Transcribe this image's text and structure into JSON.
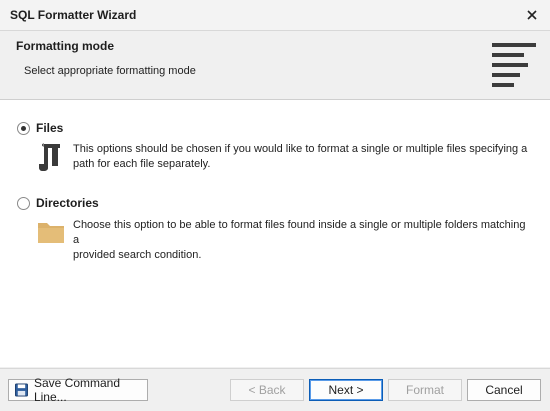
{
  "window": {
    "title": "SQL Formatter Wizard"
  },
  "header": {
    "title": "Formatting mode",
    "subtitle": "Select appropriate formatting mode"
  },
  "options": [
    {
      "label": "Files",
      "checked": true,
      "description_lines": [
        "This options should be chosen if you would like to format a single or multiple files specifying a",
        "path for each file separately."
      ],
      "icon": "file-icon"
    },
    {
      "label": "Directories",
      "checked": false,
      "description_lines": [
        "Choose this option to be able to format files found inside a single or multiple folders matching a",
        "provided search condition."
      ],
      "icon": "folder-icon"
    }
  ],
  "footer": {
    "save_command_line": "Save Command Line...",
    "back": "< Back",
    "next": "Next >",
    "format": "Format",
    "cancel": "Cancel"
  },
  "colors": {
    "folder": "#dcb26b",
    "primary_border": "#0b5db7"
  }
}
